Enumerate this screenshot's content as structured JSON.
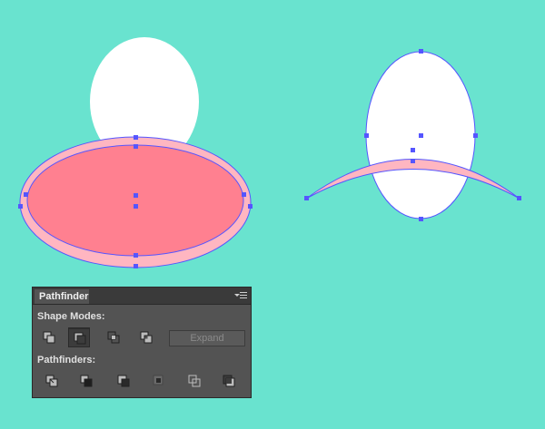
{
  "artboard": {
    "background": "#69e3cf",
    "left_group": {
      "top_shape": "white-ellipse",
      "front_shape": "pink-ellipse",
      "fill": "#ff8090",
      "outline_fill": "#ffb6c1"
    },
    "right_group": {
      "top_shape": "white-ellipse",
      "front_shape": "pink-arc",
      "fill": "#ffb6c1"
    },
    "selection_color": "#5555ff"
  },
  "pathfinder_panel": {
    "tab_label": "Pathfinder",
    "menu_icon": "panel-menu-icon",
    "shape_modes_label": "Shape Modes:",
    "shape_modes": [
      {
        "icon": "unite-icon",
        "active": false
      },
      {
        "icon": "minus-front-icon",
        "active": true
      },
      {
        "icon": "intersect-icon",
        "active": false
      },
      {
        "icon": "exclude-icon",
        "active": false
      }
    ],
    "expand_label": "Expand",
    "pathfinders_label": "Pathfinders:",
    "pathfinders": [
      {
        "icon": "divide-icon"
      },
      {
        "icon": "trim-icon"
      },
      {
        "icon": "merge-icon"
      },
      {
        "icon": "crop-icon"
      },
      {
        "icon": "outline-icon"
      },
      {
        "icon": "minus-back-icon"
      }
    ]
  }
}
